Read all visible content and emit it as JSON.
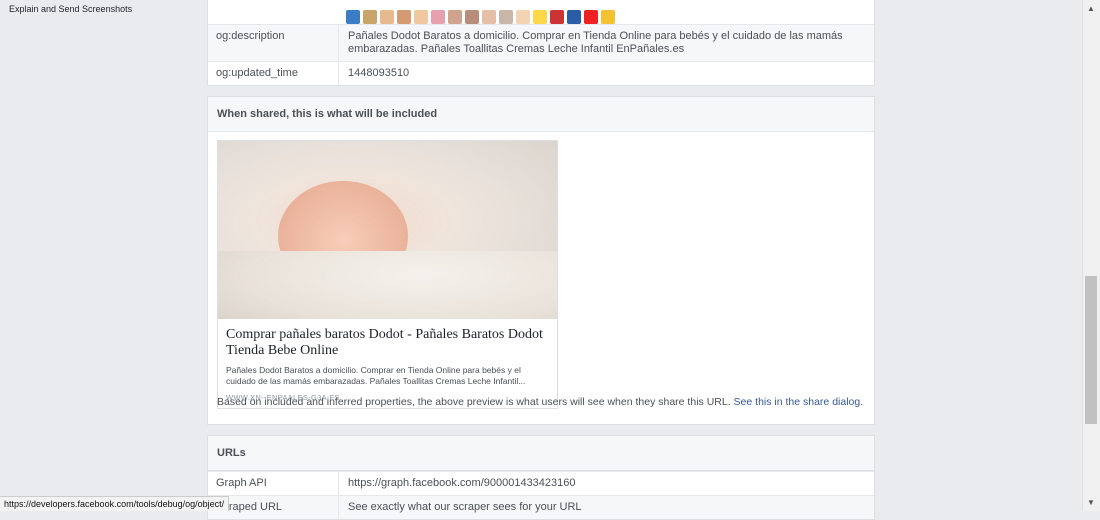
{
  "sidebar": {
    "link_label": "Explain and Send Screenshots"
  },
  "props": [
    {
      "key": "og:description",
      "value": "Pañales Dodot Baratos a domicilio. Comprar en Tienda Online para bebés y el cuidado de las mamás embarazadas. Pañales Toallitas Cremas Leche Infantil EnPañales.es"
    },
    {
      "key": "og:updated_time",
      "value": "1448093510"
    }
  ],
  "share": {
    "heading": "When shared, this is what will be included",
    "card_title": "Comprar pañales baratos Dodot - Pañales Baratos Dodot Tienda Bebe Online",
    "card_desc": "Pañales Dodot Baratos a domicilio. Comprar en Tienda Online para bebés y el cuidado de las mamás embarazadas. Pañales Toallitas Cremas Leche Infantil...",
    "card_domain": "WWW.XN--ENPAALES-G3A.ES",
    "note": "Based on included and inferred properties, the above preview is what users will see when they share this URL.",
    "note_link": "See this in the share dialog."
  },
  "urls": {
    "heading": "URLs",
    "rows": [
      {
        "key": "Graph API",
        "value": "https://graph.facebook.com/900001433423160"
      },
      {
        "key": "Scraped URL",
        "value": "See exactly what our scraper sees for your URL"
      }
    ]
  },
  "status_bar": "https://developers.facebook.com/tools/debug/og/object/",
  "thumb_colors": [
    "#3b7cc7",
    "#c8a36a",
    "#e6b98e",
    "#d49a72",
    "#f0c8a0",
    "#e7a0b0",
    "#cfa38d",
    "#b88e7a",
    "#e4c0a8",
    "#c9b6a6",
    "#f2d4b5",
    "#ffd84a",
    "#c33",
    "#2a5ca8",
    "#e22",
    "#f2c230"
  ]
}
